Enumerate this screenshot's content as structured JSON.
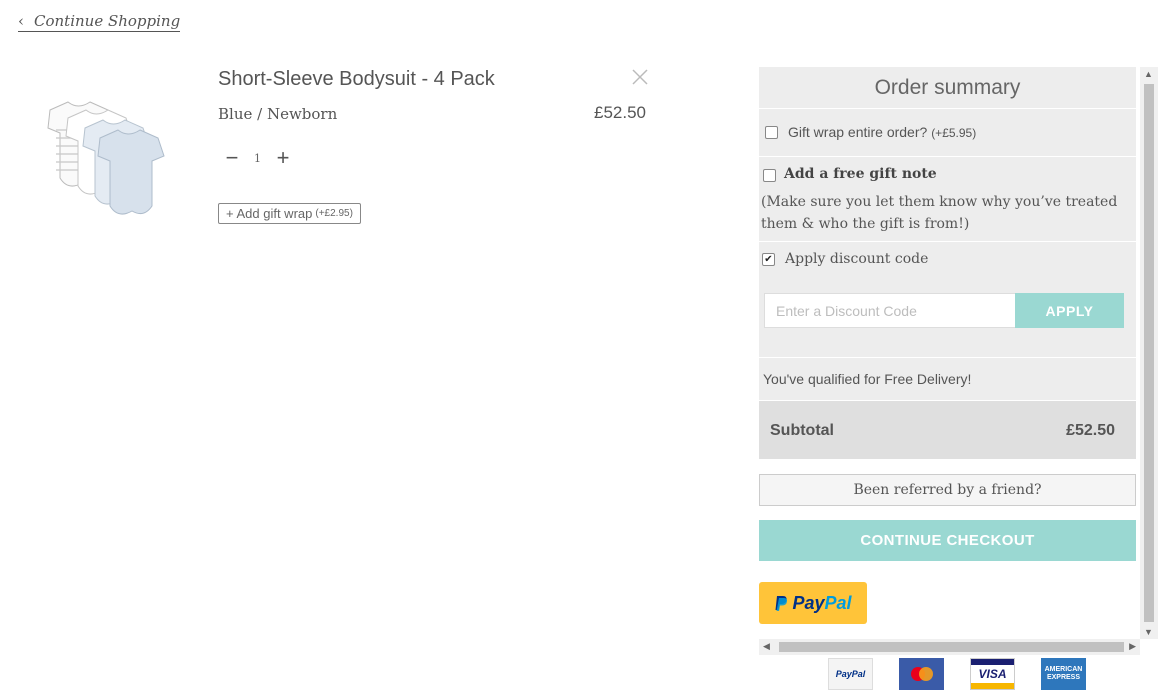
{
  "nav": {
    "continue_label": "Continue Shopping"
  },
  "product": {
    "title": "Short-Sleeve Bodysuit - 4 Pack",
    "variant": "Blue / Newborn",
    "price": "£52.50",
    "quantity": "1",
    "gift_wrap_label": "+ Add gift wrap",
    "gift_wrap_price": "(+£2.95)"
  },
  "summary": {
    "title": "Order summary",
    "gift_wrap_label": "Gift wrap entire order?",
    "gift_wrap_price": "(+£5.95)",
    "gift_wrap_checked": false,
    "gift_note_title": "Add a free gift note",
    "gift_note_checked": false,
    "gift_note_desc": "(Make sure you let them know why you’ve treated them & who the gift is from!)",
    "discount_label": "Apply discount code",
    "discount_checked": true,
    "discount_placeholder": "Enter a Discount Code",
    "apply_label": "APPLY",
    "delivery_text": "You've qualified for Free Delivery!",
    "subtotal_label": "Subtotal",
    "subtotal_value": "£52.50",
    "referred_label": "Been referred by a friend?",
    "checkout_label": "CONTINUE CHECKOUT",
    "paypal_pay": "Pay",
    "paypal_pal": "Pal"
  },
  "payment_methods": {
    "paypal": "PayPal",
    "visa": "VISA",
    "amex": "AMERICAN EXPRESS"
  },
  "colors": {
    "accent": "#9ad8d2",
    "panel_bg": "#ededed",
    "paypal_yellow": "#ffc439"
  }
}
